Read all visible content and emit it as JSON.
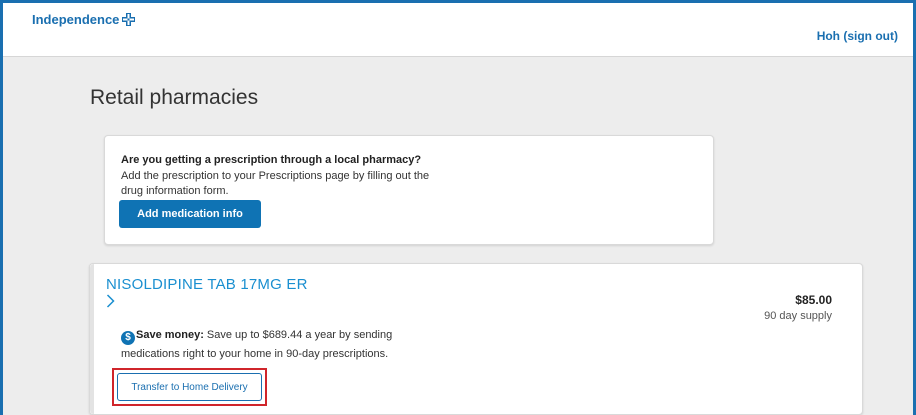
{
  "header": {
    "logo_text": "Independence",
    "logo_icon": "cross-icon",
    "user_link": "Hoh (sign out)"
  },
  "page": {
    "title": "Retail pharmacies"
  },
  "local_pharmacy_card": {
    "question": "Are you getting a prescription through a local pharmacy?",
    "description": "Add the prescription to your Prescriptions page by filling out the drug information form.",
    "button_label": "Add medication info"
  },
  "drug_card": {
    "drug_name": "NISOLDIPINE TAB 17MG ER",
    "price": "$85.00",
    "supply": "90 day supply",
    "save_icon_glyph": "$",
    "save_label": "Save money:",
    "save_text": " Save up to $689.44 a year by sending medications right to your home in 90-day prescriptions.",
    "transfer_button_label": "Transfer to Home Delivery"
  },
  "colors": {
    "brand_blue": "#1a6fb0",
    "button_blue": "#0f73b4",
    "drug_link_blue": "#1a8fd0",
    "highlight_red": "#d0252b"
  }
}
